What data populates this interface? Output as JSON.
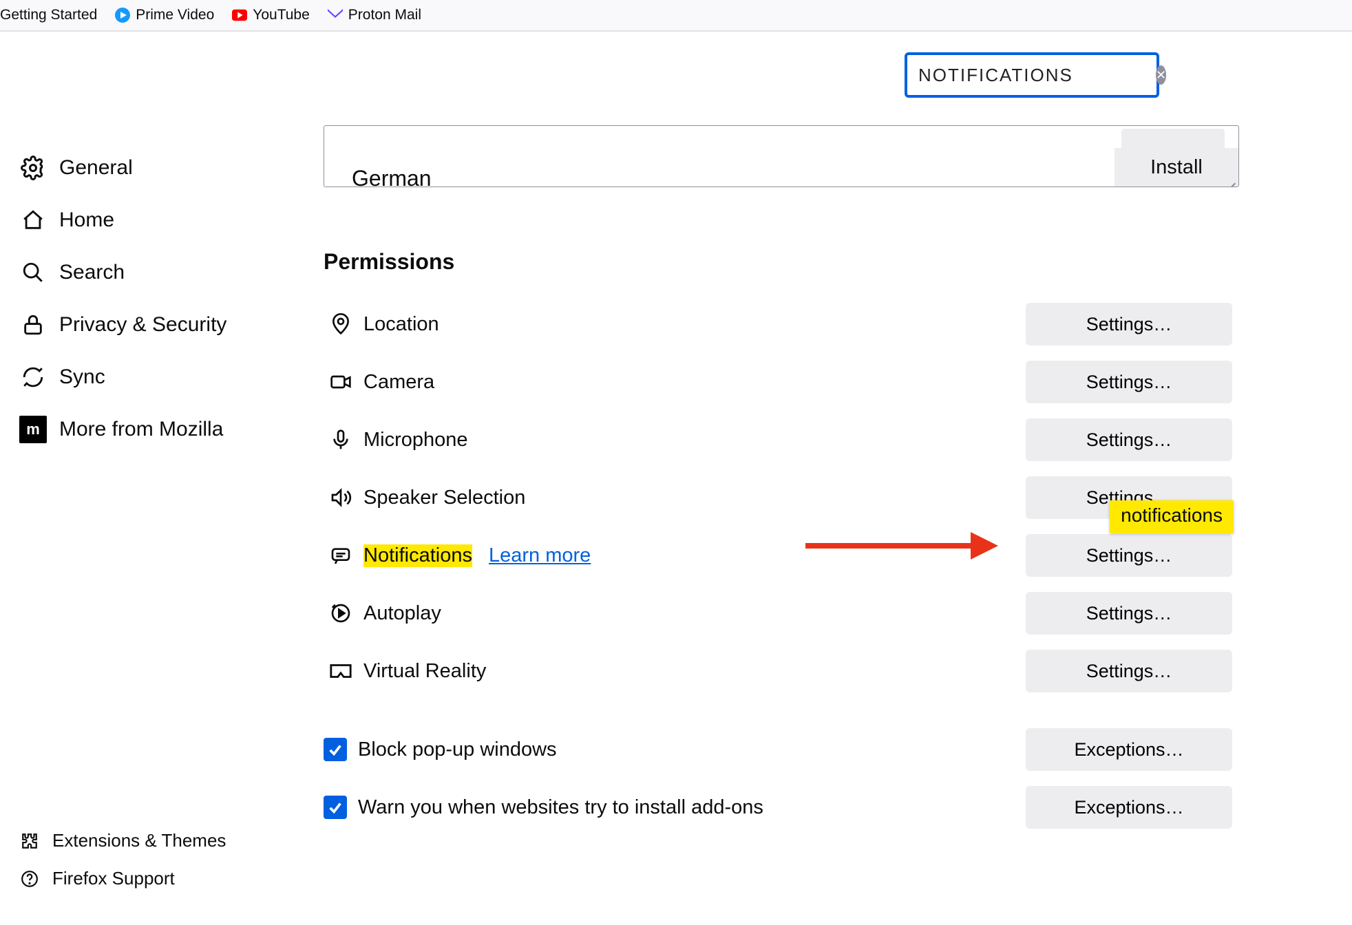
{
  "bookmarks": {
    "getting_started": "Getting Started",
    "prime_video": "Prime Video",
    "youtube": "YouTube",
    "proton_mail": "Proton Mail"
  },
  "search": {
    "value": "NOTIFICATIONS"
  },
  "sidebar": {
    "general": "General",
    "home": "Home",
    "search": "Search",
    "privacy": "Privacy & Security",
    "sync": "Sync",
    "more_mozilla": "More from Mozilla",
    "extensions": "Extensions & Themes",
    "support": "Firefox Support",
    "moz_icon": "m"
  },
  "languages": {
    "german": "German",
    "install": "Install"
  },
  "permissions": {
    "heading": "Permissions",
    "location": "Location",
    "camera": "Camera",
    "microphone": "Microphone",
    "speaker": "Speaker Selection",
    "notifications": "Notifications",
    "learn_more": "Learn more",
    "autoplay": "Autoplay",
    "vr": "Virtual Reality",
    "settings_btn": "Settings…",
    "tooltip": "notifications"
  },
  "checkboxes": {
    "block_popups": "Block pop-up windows",
    "warn_addons": "Warn you when websites try to install add-ons",
    "exceptions_btn": "Exceptions…"
  }
}
